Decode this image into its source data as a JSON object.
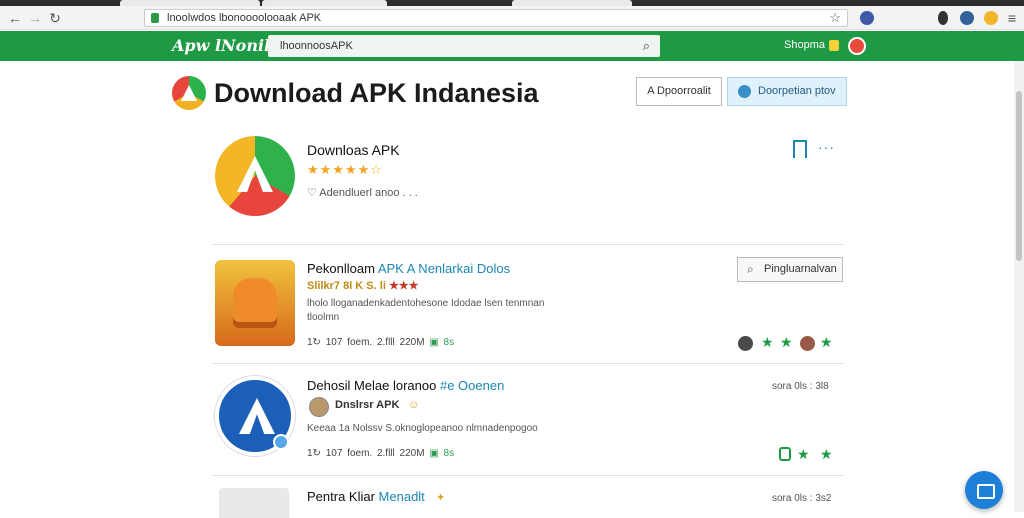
{
  "browser": {
    "url": "lnoolwdos lbonoooolooaak APK",
    "nav": {
      "back": "←",
      "forward": "→",
      "reload": "↻"
    },
    "star": "☆"
  },
  "header": {
    "logo": "Apw lNonili",
    "search_value": "lhoonnoosAPK",
    "search_icon": "search-icon",
    "user_label": "Shopma",
    "accent": "#1f9a44"
  },
  "page": {
    "title": "Download APK Indanesia",
    "btn_outline": "A Dpoorroalit",
    "btn_soft": "Doorpetian ptov"
  },
  "feature": {
    "name": "Downloas APK",
    "stars": "★★★★★☆",
    "meta": "♡ Adendluerl anoo . . ."
  },
  "items": [
    {
      "title_a": "Pekonlloam ",
      "title_hl": "APK A Nenlarkai ",
      "title_b": "Dolos",
      "sub": "Slilkr7  8l K S. li ",
      "sub_red": "★★★",
      "desc": "lholo lloganadenkadentohesone Idodae lsen tenmnan tloolmn",
      "stats_a": "1↻ 107 foem.   2.flll   220M  ",
      "stats_green": "▣ 8s",
      "action": "Pingluarnalvan"
    },
    {
      "title_a": "Dehosil Melae loranoo ",
      "title_hl": "#e Ooenen",
      "sub": "Dnslrsr APK",
      "desc": "Keeaa 1a Nolssv  S.oknoglopeanoo nlmnadenpogoo",
      "stats_a": "1↻ 107 foem.   2.flll   220M  ",
      "stats_green": "▣ 8s",
      "date": "sora 0ls : 3l8"
    },
    {
      "title_a": "Pentra Kliar ",
      "title_hl": "Menadlt",
      "date": "sora 0ls : 3s2"
    }
  ]
}
